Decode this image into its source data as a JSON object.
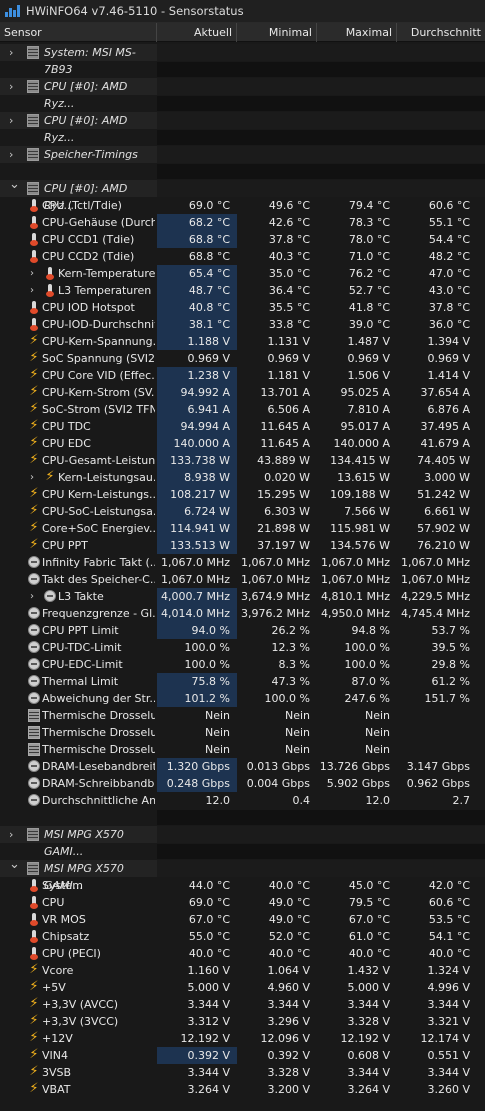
{
  "window": {
    "title": "HWiNFO64 v7.46-5110 - Sensorstatus"
  },
  "columns": {
    "sensor": "Sensor",
    "current": "Aktuell",
    "min": "Minimal",
    "max": "Maximal",
    "avg": "Durchschnitt"
  },
  "groups": [
    {
      "name": "System: MSI MS-7B93",
      "expanded": false
    },
    {
      "name": "CPU [#0]: AMD Ryz...",
      "expanded": false
    },
    {
      "name": "CPU [#0]: AMD Ryz...",
      "expanded": false
    },
    {
      "name": "Speicher-Timings",
      "expanded": false
    },
    {
      "name": "CPU [#0]: AMD Ryz...",
      "expanded": true
    },
    {
      "name": "MSI MPG X570 GAMI...",
      "expanded": false
    },
    {
      "name": "MSI MPG X570 GAMI...",
      "expanded": true
    }
  ],
  "cpu_sensors": [
    {
      "label": "CPU (Tctl/Tdie)",
      "icon": "thermometer-icon",
      "current": "69.0 °C",
      "min": "49.6 °C",
      "max": "79.4 °C",
      "avg": "60.6 °C",
      "hl": false
    },
    {
      "label": "CPU-Gehäuse (Durch...",
      "icon": "thermometer-icon",
      "current": "68.2 °C",
      "min": "42.6 °C",
      "max": "78.3 °C",
      "avg": "55.1 °C",
      "hl": true
    },
    {
      "label": "CPU CCD1 (Tdie)",
      "icon": "thermometer-icon",
      "current": "68.8 °C",
      "min": "37.8 °C",
      "max": "78.0 °C",
      "avg": "54.4 °C",
      "hl": true
    },
    {
      "label": "CPU CCD2 (Tdie)",
      "icon": "thermometer-icon",
      "current": "68.8 °C",
      "min": "40.3 °C",
      "max": "71.0 °C",
      "avg": "48.2 °C",
      "hl": false
    },
    {
      "label": "Kern-Temperaturen",
      "icon": "thermometer-icon",
      "current": "65.4 °C",
      "min": "35.0 °C",
      "max": "76.2 °C",
      "avg": "47.0 °C",
      "hl": true,
      "sub": true
    },
    {
      "label": "L3 Temperaturen",
      "icon": "thermometer-icon",
      "current": "48.7 °C",
      "min": "36.4 °C",
      "max": "52.7 °C",
      "avg": "43.0 °C",
      "hl": true,
      "sub": true
    },
    {
      "label": "CPU IOD Hotspot",
      "icon": "thermometer-icon",
      "current": "40.8 °C",
      "min": "35.5 °C",
      "max": "41.8 °C",
      "avg": "37.8 °C",
      "hl": true
    },
    {
      "label": "CPU-IOD-Durchschnitt",
      "icon": "thermometer-icon",
      "current": "38.1 °C",
      "min": "33.8 °C",
      "max": "39.0 °C",
      "avg": "36.0 °C",
      "hl": true
    },
    {
      "label": "CPU-Kern-Spannung...",
      "icon": "bolt-icon",
      "current": "1.188 V",
      "min": "1.131 V",
      "max": "1.487 V",
      "avg": "1.394 V",
      "hl": true
    },
    {
      "label": "SoC Spannung (SVI2...",
      "icon": "bolt-icon",
      "current": "0.969 V",
      "min": "0.969 V",
      "max": "0.969 V",
      "avg": "0.969 V",
      "hl": false
    },
    {
      "label": "CPU Core VID (Effec...",
      "icon": "bolt-icon",
      "current": "1.238 V",
      "min": "1.181 V",
      "max": "1.506 V",
      "avg": "1.414 V",
      "hl": true
    },
    {
      "label": "CPU-Kern-Strom (SV...",
      "icon": "bolt-icon",
      "current": "94.992 A",
      "min": "13.701 A",
      "max": "95.025 A",
      "avg": "37.654 A",
      "hl": true
    },
    {
      "label": "SoC-Strom (SVI2 TFN)",
      "icon": "bolt-icon",
      "current": "6.941 A",
      "min": "6.506 A",
      "max": "7.810 A",
      "avg": "6.876 A",
      "hl": true
    },
    {
      "label": "CPU TDC",
      "icon": "bolt-icon",
      "current": "94.994 A",
      "min": "11.645 A",
      "max": "95.017 A",
      "avg": "37.495 A",
      "hl": true
    },
    {
      "label": "CPU EDC",
      "icon": "bolt-icon",
      "current": "140.000 A",
      "min": "11.645 A",
      "max": "140.000 A",
      "avg": "41.679 A",
      "hl": true
    },
    {
      "label": "CPU-Gesamt-Leistun...",
      "icon": "bolt-icon",
      "current": "133.738 W",
      "min": "43.889 W",
      "max": "134.415 W",
      "avg": "74.405 W",
      "hl": true
    },
    {
      "label": "Kern-Leistungsau...",
      "icon": "bolt-icon",
      "current": "8.938 W",
      "min": "0.020 W",
      "max": "13.615 W",
      "avg": "3.000 W",
      "hl": true,
      "sub": true
    },
    {
      "label": "CPU Kern-Leistungs...",
      "icon": "bolt-icon",
      "current": "108.217 W",
      "min": "15.295 W",
      "max": "109.188 W",
      "avg": "51.242 W",
      "hl": true
    },
    {
      "label": "CPU-SoC-Leistungsa...",
      "icon": "bolt-icon",
      "current": "6.724 W",
      "min": "6.303 W",
      "max": "7.566 W",
      "avg": "6.661 W",
      "hl": true
    },
    {
      "label": "Core+SoC Energiev...",
      "icon": "bolt-icon",
      "current": "114.941 W",
      "min": "21.898 W",
      "max": "115.981 W",
      "avg": "57.902 W",
      "hl": true
    },
    {
      "label": "CPU PPT",
      "icon": "bolt-icon",
      "current": "133.513 W",
      "min": "37.197 W",
      "max": "134.576 W",
      "avg": "76.210 W",
      "hl": true
    },
    {
      "label": "Infinity Fabric Takt (...",
      "icon": "clock-icon",
      "current": "1,067.0 MHz",
      "min": "1,067.0 MHz",
      "max": "1,067.0 MHz",
      "avg": "1,067.0 MHz",
      "hl": false
    },
    {
      "label": "Takt des Speicher-C...",
      "icon": "clock-icon",
      "current": "1,067.0 MHz",
      "min": "1,067.0 MHz",
      "max": "1,067.0 MHz",
      "avg": "1,067.0 MHz",
      "hl": false
    },
    {
      "label": "L3 Takte",
      "icon": "clock-icon",
      "current": "4,000.7 MHz",
      "min": "3,674.9 MHz",
      "max": "4,810.1 MHz",
      "avg": "4,229.5 MHz",
      "hl": true,
      "sub": true
    },
    {
      "label": "Frequenzgrenze - Gl...",
      "icon": "clock-icon",
      "current": "4,014.0 MHz",
      "min": "3,976.2 MHz",
      "max": "4,950.0 MHz",
      "avg": "4,745.4 MHz",
      "hl": true
    },
    {
      "label": "CPU PPT Limit",
      "icon": "clock-icon",
      "current": "94.0 %",
      "min": "26.2 %",
      "max": "94.8 %",
      "avg": "53.7 %",
      "hl": true
    },
    {
      "label": "CPU-TDC-Limit",
      "icon": "clock-icon",
      "current": "100.0 %",
      "min": "12.3 %",
      "max": "100.0 %",
      "avg": "39.5 %",
      "hl": false
    },
    {
      "label": "CPU-EDC-Limit",
      "icon": "clock-icon",
      "current": "100.0 %",
      "min": "8.3 %",
      "max": "100.0 %",
      "avg": "29.8 %",
      "hl": false
    },
    {
      "label": "Thermal Limit",
      "icon": "clock-icon",
      "current": "75.8 %",
      "min": "47.3 %",
      "max": "87.0 %",
      "avg": "61.2 %",
      "hl": true
    },
    {
      "label": "Abweichung der Str...",
      "icon": "clock-icon",
      "current": "101.2 %",
      "min": "100.0 %",
      "max": "247.6 %",
      "avg": "151.7 %",
      "hl": true
    },
    {
      "label": "Thermische Drosselu...",
      "icon": "chip-icon",
      "current": "Nein",
      "min": "Nein",
      "max": "Nein",
      "avg": "",
      "hl": false
    },
    {
      "label": "Thermische Drosselu...",
      "icon": "chip-icon",
      "current": "Nein",
      "min": "Nein",
      "max": "Nein",
      "avg": "",
      "hl": false
    },
    {
      "label": "Thermische Drosselu...",
      "icon": "chip-icon",
      "current": "Nein",
      "min": "Nein",
      "max": "Nein",
      "avg": "",
      "hl": false
    },
    {
      "label": "DRAM-Lesebandbreite",
      "icon": "clock-icon",
      "current": "1.320 Gbps",
      "min": "0.013 Gbps",
      "max": "13.726 Gbps",
      "avg": "3.147 Gbps",
      "hl": true
    },
    {
      "label": "DRAM-Schreibbandb...",
      "icon": "clock-icon",
      "current": "0.248 Gbps",
      "min": "0.004 Gbps",
      "max": "5.902 Gbps",
      "avg": "0.962 Gbps",
      "hl": true
    },
    {
      "label": "Durchschnittliche An...",
      "icon": "clock-icon",
      "current": "12.0",
      "min": "0.4",
      "max": "12.0",
      "avg": "2.7",
      "hl": false
    }
  ],
  "board_sensors": [
    {
      "label": "System",
      "icon": "thermometer-icon",
      "current": "44.0 °C",
      "min": "40.0 °C",
      "max": "45.0 °C",
      "avg": "42.0 °C",
      "hl": false
    },
    {
      "label": "CPU",
      "icon": "thermometer-icon",
      "current": "69.0 °C",
      "min": "49.0 °C",
      "max": "79.5 °C",
      "avg": "60.6 °C",
      "hl": false
    },
    {
      "label": "VR MOS",
      "icon": "thermometer-icon",
      "current": "67.0 °C",
      "min": "49.0 °C",
      "max": "67.0 °C",
      "avg": "53.5 °C",
      "hl": false
    },
    {
      "label": "Chipsatz",
      "icon": "thermometer-icon",
      "current": "55.0 °C",
      "min": "52.0 °C",
      "max": "61.0 °C",
      "avg": "54.1 °C",
      "hl": false
    },
    {
      "label": "CPU (PECI)",
      "icon": "thermometer-icon",
      "current": "40.0 °C",
      "min": "40.0 °C",
      "max": "40.0 °C",
      "avg": "40.0 °C",
      "hl": false
    },
    {
      "label": "Vcore",
      "icon": "bolt-icon",
      "current": "1.160 V",
      "min": "1.064 V",
      "max": "1.432 V",
      "avg": "1.324 V",
      "hl": false
    },
    {
      "label": "+5V",
      "icon": "bolt-icon",
      "current": "5.000 V",
      "min": "4.960 V",
      "max": "5.000 V",
      "avg": "4.996 V",
      "hl": false
    },
    {
      "label": "+3,3V (AVCC)",
      "icon": "bolt-icon",
      "current": "3.344 V",
      "min": "3.344 V",
      "max": "3.344 V",
      "avg": "3.344 V",
      "hl": false
    },
    {
      "label": "+3,3V (3VCC)",
      "icon": "bolt-icon",
      "current": "3.312 V",
      "min": "3.296 V",
      "max": "3.328 V",
      "avg": "3.321 V",
      "hl": false
    },
    {
      "label": "+12V",
      "icon": "bolt-icon",
      "current": "12.192 V",
      "min": "12.096 V",
      "max": "12.192 V",
      "avg": "12.174 V",
      "hl": false
    },
    {
      "label": "VIN4",
      "icon": "bolt-icon",
      "current": "0.392 V",
      "min": "0.392 V",
      "max": "0.608 V",
      "avg": "0.551 V",
      "hl": true
    },
    {
      "label": "3VSB",
      "icon": "bolt-icon",
      "current": "3.344 V",
      "min": "3.328 V",
      "max": "3.344 V",
      "avg": "3.344 V",
      "hl": false
    },
    {
      "label": "VBAT",
      "icon": "bolt-icon",
      "current": "3.264 V",
      "min": "3.200 V",
      "max": "3.264 V",
      "avg": "3.260 V",
      "hl": false
    }
  ]
}
